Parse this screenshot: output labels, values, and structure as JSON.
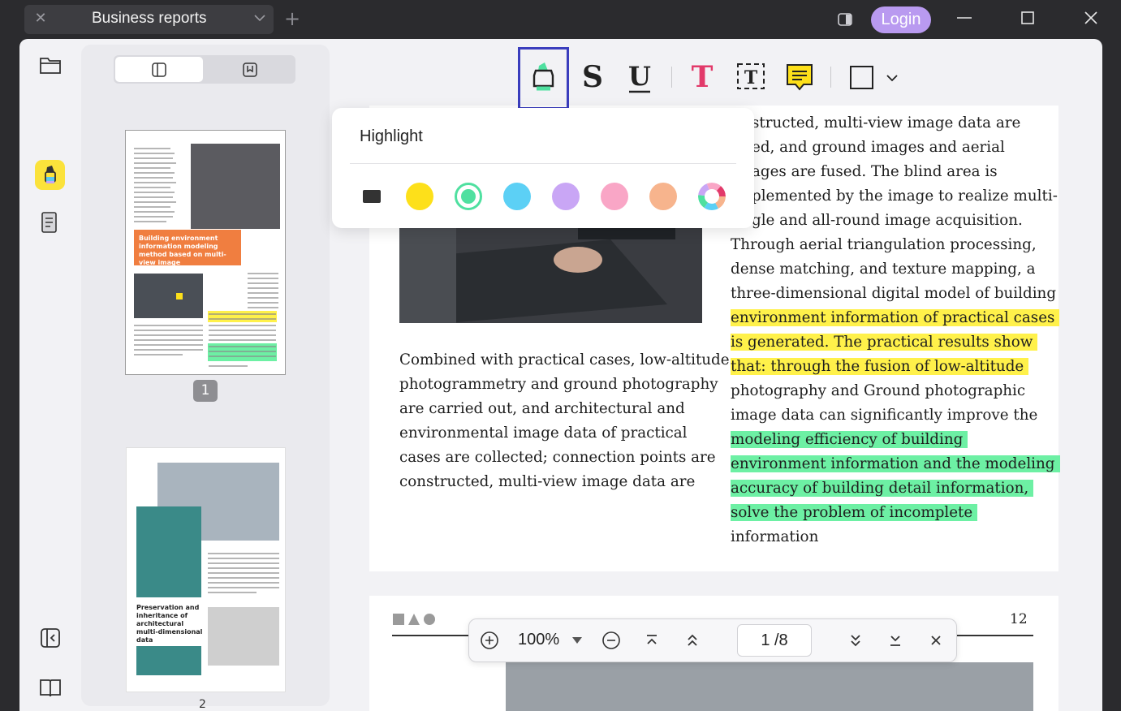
{
  "tab": {
    "title": "Business reports"
  },
  "header": {
    "login_label": "Login"
  },
  "popup": {
    "title": "Highlight",
    "colors": [
      "#333333",
      "#fde01a",
      "#4fe0a0",
      "#5cd0f5",
      "#c9a6f5",
      "#f9a6c6",
      "#f7b48d"
    ],
    "selected_color": "#4fe0a0"
  },
  "thumbnails": {
    "page1_label": "1",
    "page2_label": "2"
  },
  "document": {
    "left_column": [
      "Combined with practical cases, low-altitude",
      "photogrammetry and ground photography",
      "are carried out, and architectural and",
      "environmental image data of practical",
      "cases are collected; connection points are",
      "constructed, multi-view image data are"
    ],
    "right_column": [
      {
        "text": "structed, multi-view image data are",
        "hl": ""
      },
      {
        "text": "ed, and ground images and aerial",
        "hl": ""
      },
      {
        "text": "ages are fused. The blind area is",
        "hl": ""
      },
      {
        "text": "plemented by the image to realize multi-",
        "hl": ""
      },
      {
        "text": "gle and all-round image acquisition.",
        "hl": ""
      },
      {
        "text": "Through aerial triangulation processing,",
        "hl": ""
      },
      {
        "text": "dense matching, and texture mapping, a",
        "hl": ""
      },
      {
        "text": "three-dimensional digital model of building",
        "hl": ""
      },
      {
        "text": "environment information of practical cases",
        "hl": "y"
      },
      {
        "text": "is generated. The practical results show",
        "hl": "y"
      },
      {
        "text": "that: through the fusion of low-altitude",
        "hl": "y"
      },
      {
        "text": "photography and Ground photographic",
        "hl": ""
      },
      {
        "text": "image data can significantly improve the",
        "hl": ""
      },
      {
        "text": "modeling efficiency of building",
        "hl": "g"
      },
      {
        "text": "environment information and the modeling",
        "hl": "g"
      },
      {
        "text": "accuracy of building detail information,",
        "hl": "g"
      },
      {
        "text": "solve the problem of incomplete",
        "hl": "g"
      },
      {
        "text": "information",
        "hl": ""
      }
    ],
    "page2_number": "12"
  },
  "thumb1": {
    "heading": "Building environment information modeling method based on multi-view image"
  },
  "thumb2": {
    "heading": "Preservation and inheritance of architectural multi-dimensional data"
  },
  "navbar": {
    "zoom": "100%",
    "page": "1 /8"
  }
}
